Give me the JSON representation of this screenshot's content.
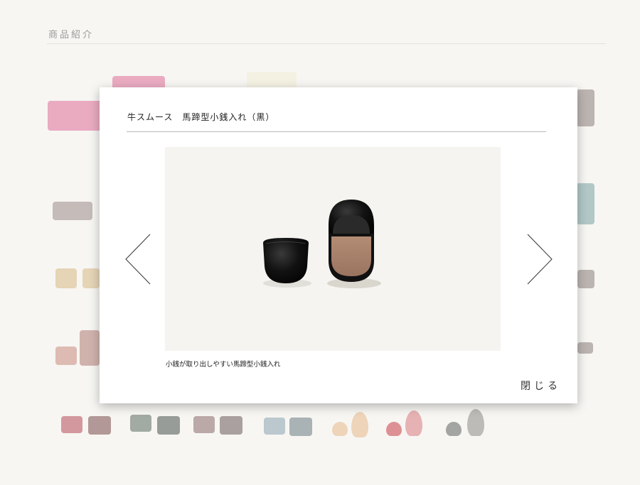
{
  "page": {
    "heading": "商品紹介"
  },
  "background_thumbnails": {
    "colors": {
      "pink": "#e06d97",
      "cream": "#f3ecd6",
      "mauve": "#9d8a86",
      "taupe": "#8b7e78",
      "teal": "#7aa3a3",
      "tan": "#d8b884",
      "rose": "#c98a7c",
      "dark_rose": "#b64a58",
      "grey_green": "#5d6b63",
      "light_blue": "#8aa3ae",
      "peach": "#e8b888",
      "red": "#c93e45",
      "dark_grey": "#5f6360"
    }
  },
  "modal": {
    "title": "牛スムース　馬蹄型小銭入れ（黒）",
    "caption": "小銭が取り出しやすい馬蹄型小銭入れ",
    "close_label": "閉じる",
    "prev_icon": "chevron-left-icon",
    "next_icon": "chevron-right-icon",
    "product_colors": {
      "leather": "#151515",
      "interior": "#a78068"
    }
  }
}
